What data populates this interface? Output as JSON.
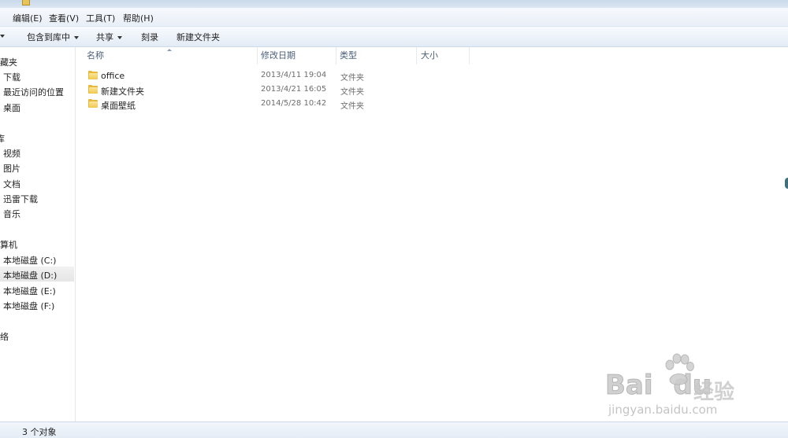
{
  "menu": {
    "edit": "编辑(E)",
    "view": "查看(V)",
    "tools": "工具(T)",
    "help": "帮助(H)"
  },
  "toolbar": {
    "include_in_library": "包含到库中",
    "share": "共享",
    "burn": "刻录",
    "new_folder": "新建文件夹"
  },
  "nav": {
    "favorites": "收藏夹",
    "downloads": "下载",
    "recent_places": "最近访问的位置",
    "desktop": "桌面",
    "libraries": "库",
    "videos": "视频",
    "pictures": "图片",
    "documents": "文档",
    "xunlei": "迅雷下载",
    "music": "音乐",
    "computer": "计算机",
    "drive_c": "本地磁盘 (C:)",
    "drive_d": "本地磁盘 (D:)",
    "drive_e": "本地磁盘 (E:)",
    "drive_f": "本地磁盘 (F:)",
    "network": "网络"
  },
  "columns": {
    "name": "名称",
    "modified": "修改日期",
    "type": "类型",
    "size": "大小"
  },
  "files": [
    {
      "name": "office",
      "modified": "2013/4/11 19:04",
      "type": "文件夹"
    },
    {
      "name": "新建文件夹",
      "modified": "2013/4/21 16:05",
      "type": "文件夹"
    },
    {
      "name": "桌面壁纸",
      "modified": "2014/5/28 10:42",
      "type": "文件夹"
    }
  ],
  "status": {
    "count": "3 个对象"
  },
  "watermark": {
    "brand": "Bai",
    "brand2": "du",
    "jingyan": "经验",
    "domain": "jingyan.baidu.com"
  },
  "colors": {
    "folder": "#e6b93d",
    "header_text": "#4c607a",
    "selected_nav": "#e6e6e6"
  },
  "icons": [
    "folder-icon",
    "sort-ascending-icon",
    "chevron-down-icon"
  ]
}
